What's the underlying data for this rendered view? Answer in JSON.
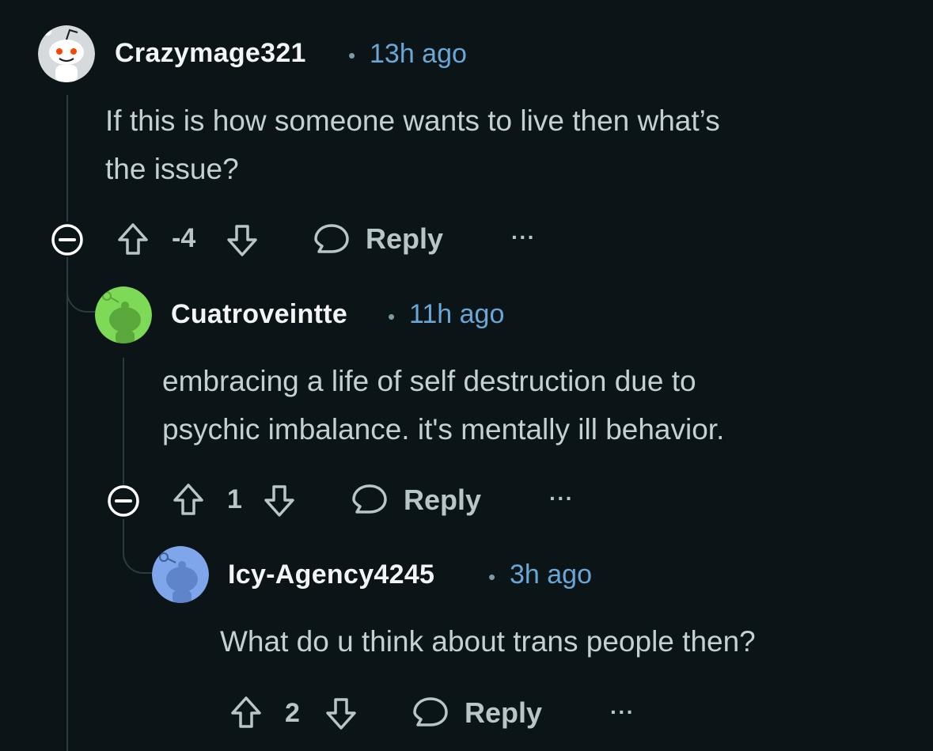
{
  "thread": {
    "comments": [
      {
        "username": "Crazymage321",
        "separator": "•",
        "time": "13h ago",
        "body_lines": [
          "If this is how someone wants to live then what’s",
          "the issue?"
        ],
        "score": "-4",
        "reply_label": "Reply",
        "more_label": "···",
        "avatar_color": "#1a2226"
      },
      {
        "username": "Cuatroveintte",
        "separator": "•",
        "time": "11h ago",
        "body_lines": [
          "embracing a life of self destruction due to",
          "psychic imbalance. it's mentally ill behavior."
        ],
        "score": "1",
        "reply_label": "Reply",
        "more_label": "···",
        "avatar_color": "#7ed957"
      },
      {
        "username": "Icy-Agency4245",
        "separator": "•",
        "time": "3h ago",
        "body_lines": [
          "What do u think about trans people then?"
        ],
        "score": "2",
        "reply_label": "Reply",
        "more_label": "···",
        "avatar_color": "#7fa6ea"
      }
    ]
  },
  "colors": {
    "background": "#0b1416",
    "username": "#f2f4f5",
    "timestamp": "#6aa6d6",
    "text": "#c4d0d3",
    "thread_line": "#2a3c42"
  }
}
